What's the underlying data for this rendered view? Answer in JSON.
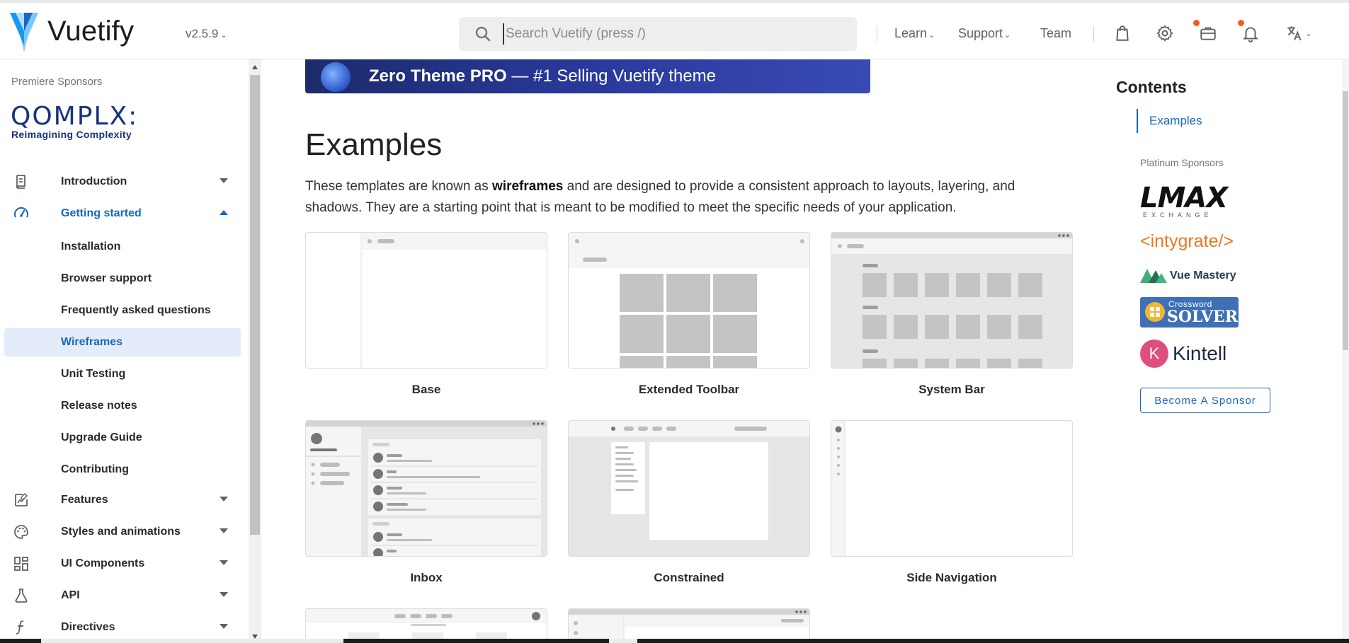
{
  "app": {
    "brand": "Vuetify",
    "version": "v2.5.9",
    "search_placeholder": "Search Vuetify (press /)",
    "nav_links": [
      "Learn",
      "Support",
      "Team"
    ]
  },
  "sidebar": {
    "sponsor_caption": "Premiere Sponsors",
    "sponsor_name": "QOMPLX:",
    "sponsor_tagline": "Reimagining Complexity",
    "groups": [
      {
        "label": "Introduction",
        "icon": "book-icon",
        "open": false
      },
      {
        "label": "Getting started",
        "icon": "speedometer-icon",
        "open": true
      },
      {
        "label": "Features",
        "icon": "edit-chart-icon",
        "open": false
      },
      {
        "label": "Styles and animations",
        "icon": "palette-icon",
        "open": false
      },
      {
        "label": "UI Components",
        "icon": "view-dashboard-icon",
        "open": false
      },
      {
        "label": "API",
        "icon": "flask-icon",
        "open": false
      },
      {
        "label": "Directives",
        "icon": "function-icon",
        "open": false
      }
    ],
    "getting_started_items": [
      {
        "label": "Installation",
        "active": false
      },
      {
        "label": "Browser support",
        "active": false
      },
      {
        "label": "Frequently asked questions",
        "active": false
      },
      {
        "label": "Wireframes",
        "active": true
      },
      {
        "label": "Unit Testing",
        "active": false
      },
      {
        "label": "Release notes",
        "active": false
      },
      {
        "label": "Upgrade Guide",
        "active": false
      },
      {
        "label": "Contributing",
        "active": false
      }
    ]
  },
  "main": {
    "banner_strong": "Zero Theme PRO",
    "banner_rest": " — #1 Selling Vuetify theme",
    "title": "Examples",
    "intro_before": "These templates are known as ",
    "intro_bold": "wireframes",
    "intro_after": " and are designed to provide a consistent approach to layouts, layering, and shadows. They are a starting point that is meant to be modified to meet the specific needs of your application.",
    "cards": [
      {
        "label": "Base"
      },
      {
        "label": "Extended Toolbar"
      },
      {
        "label": "System Bar"
      },
      {
        "label": "Inbox"
      },
      {
        "label": "Constrained"
      },
      {
        "label": "Side Navigation"
      }
    ]
  },
  "toc": {
    "title": "Contents",
    "links": [
      "Examples"
    ],
    "platinum_caption": "Platinum Sponsors",
    "sponsors": [
      "LMAX",
      "EXCHANGE",
      "<intygrate/>",
      "Vue Mastery",
      "Crossword",
      "SOLVER",
      "Kintell"
    ],
    "become_sponsor": "Become A Sponsor"
  },
  "colors": {
    "primary": "#1867c0",
    "active_bg": "#e3ecf8",
    "notification_dot": "#ff5722"
  }
}
